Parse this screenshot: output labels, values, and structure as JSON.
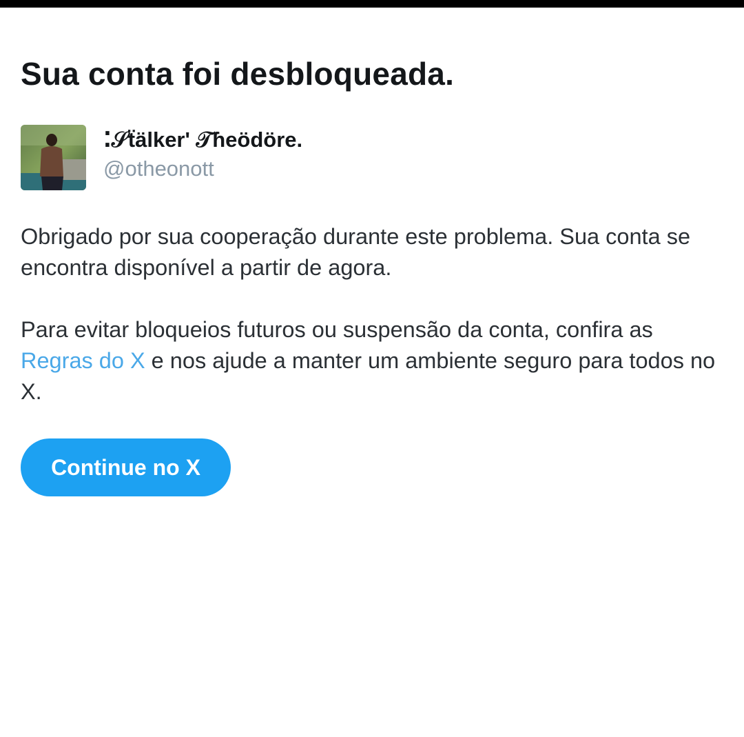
{
  "colors": {
    "accent": "#1da1f2",
    "link": "#4aa8e8",
    "handle": "#8a99a6",
    "text": "#14171a"
  },
  "page": {
    "title": "Sua conta foi desbloqueada."
  },
  "user": {
    "display_name": "⁚𝒮ẗälker' 𝒯ɦeödöre.",
    "handle": "@otheonott",
    "avatar_icon": "profile-photo"
  },
  "message": {
    "paragraph1": "Obrigado por sua cooperação durante este problema. Sua conta se encontra disponível a partir de agora.",
    "paragraph2_before": "Para evitar bloqueios futuros ou suspensão da conta, confira as ",
    "rules_link": "Regras do X",
    "paragraph2_after": " e nos ajude a manter um ambiente seguro para todos no X."
  },
  "actions": {
    "continue_label": "Continue no X"
  }
}
